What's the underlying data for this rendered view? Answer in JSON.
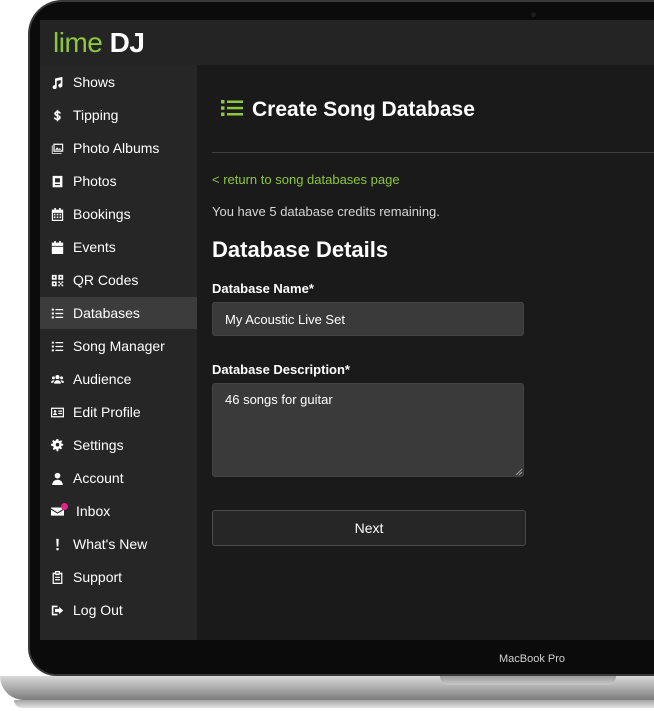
{
  "brand": {
    "logo_lime": "lime",
    "logo_dj": "DJ",
    "accent_color": "#8dc63f",
    "notification_color": "#e0248a"
  },
  "device": {
    "label": "MacBook Pro"
  },
  "sidebar": {
    "active_item": "Databases",
    "items": [
      {
        "label": "Shows",
        "icon": "music-note-icon"
      },
      {
        "label": "Tipping",
        "icon": "dollar-icon"
      },
      {
        "label": "Photo Albums",
        "icon": "photo-albums-icon"
      },
      {
        "label": "Photos",
        "icon": "photo-icon"
      },
      {
        "label": "Bookings",
        "icon": "calendar-grid-icon"
      },
      {
        "label": "Events",
        "icon": "calendar-icon"
      },
      {
        "label": "QR Codes",
        "icon": "qr-code-icon"
      },
      {
        "label": "Databases",
        "icon": "list-icon"
      },
      {
        "label": "Song Manager",
        "icon": "list-icon"
      },
      {
        "label": "Audience",
        "icon": "users-icon"
      },
      {
        "label": "Edit Profile",
        "icon": "id-card-icon"
      },
      {
        "label": "Settings",
        "icon": "gear-icon"
      },
      {
        "label": "Account",
        "icon": "user-icon"
      },
      {
        "label": "Inbox",
        "icon": "envelope-icon",
        "has_notification": true
      },
      {
        "label": "What's New",
        "icon": "exclamation-icon"
      },
      {
        "label": "Support",
        "icon": "support-icon"
      },
      {
        "label": "Log Out",
        "icon": "sign-out-icon"
      }
    ]
  },
  "main": {
    "title_icon": "list-icon",
    "title": "Create Song Database",
    "return_link": "< return to song databases page",
    "credits_text": "You have 5 database credits remaining.",
    "section_title": "Database Details",
    "name_label": "Database Name*",
    "name_value": "My Acoustic Live Set",
    "description_label": "Database Description*",
    "description_value": "46 songs for guitar",
    "next_label": "Next"
  }
}
